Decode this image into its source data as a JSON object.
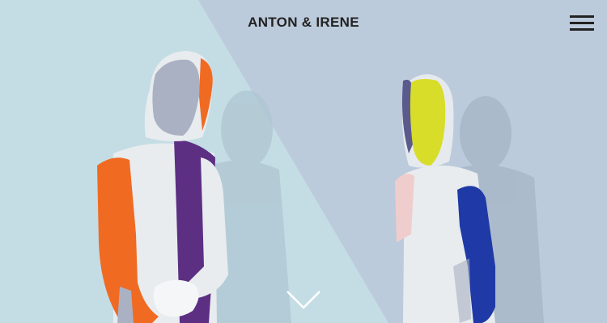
{
  "site": {
    "title": "ANTON & IRENE"
  },
  "header": {
    "menu_icon": "hamburger-menu-icon"
  },
  "hero": {
    "scroll_icon": "chevron-down-icon"
  },
  "colors": {
    "background_left": "#c4dde5",
    "background_right": "#bccbdb",
    "text": "#222222",
    "suit_white": "#e8ecef",
    "accent_orange": "#f06a22",
    "accent_purple": "#5d2f83",
    "accent_yellow": "#d8dd2a",
    "accent_blue": "#1f3aa6",
    "hood_grey": "#aab1c3"
  }
}
